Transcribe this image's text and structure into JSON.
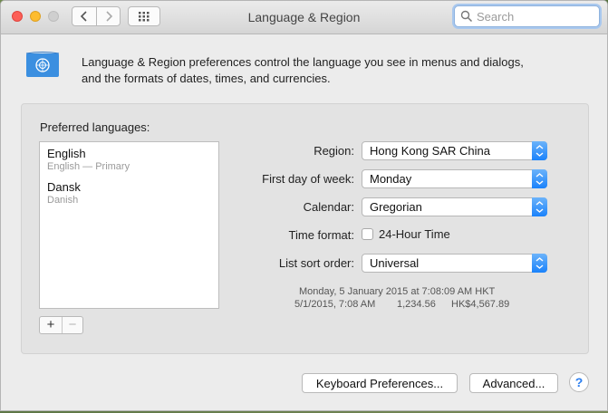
{
  "window": {
    "title": "Language & Region"
  },
  "search": {
    "placeholder": "Search",
    "value": ""
  },
  "description": {
    "line1": "Language & Region preferences control the language you see in menus and dialogs,",
    "line2": "and the formats of dates, times, and currencies."
  },
  "preferred": {
    "label": "Preferred languages:",
    "languages": [
      {
        "name": "English",
        "sub": "English — Primary"
      },
      {
        "name": "Dansk",
        "sub": "Danish"
      }
    ],
    "add_label": "+",
    "remove_label": "−"
  },
  "settings": {
    "region": {
      "label": "Region:",
      "value": "Hong Kong SAR China"
    },
    "first_day": {
      "label": "First day of week:",
      "value": "Monday"
    },
    "calendar": {
      "label": "Calendar:",
      "value": "Gregorian"
    },
    "time_format": {
      "label": "Time format:",
      "checkbox_label": "24-Hour Time",
      "checked": false
    },
    "sort_order": {
      "label": "List sort order:",
      "value": "Universal"
    }
  },
  "sample": {
    "long_date": "Monday, 5 January 2015 at 7:08:09 AM HKT",
    "short_date": "5/1/2015, 7:08 AM",
    "number": "1,234.56",
    "currency": "HK$4,567.89"
  },
  "buttons": {
    "keyboard": "Keyboard Preferences...",
    "advanced": "Advanced...",
    "help": "?"
  },
  "icons": {
    "flag": "un-flag-icon",
    "search": "search-icon",
    "back": "chevron-left-icon",
    "forward": "chevron-right-icon",
    "grid": "grid-icon"
  },
  "colors": {
    "accent": "#1a82fb",
    "flag_blue": "#3b8fe0"
  }
}
